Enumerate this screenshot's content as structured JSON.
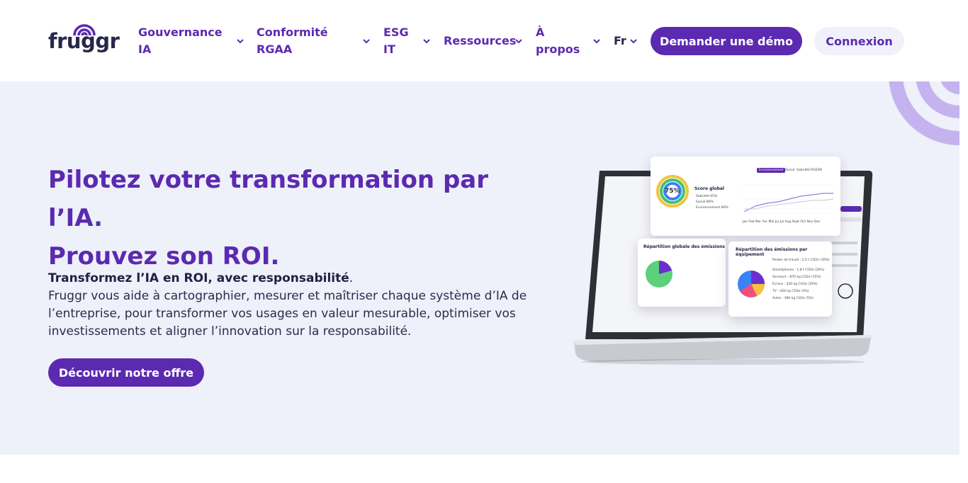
{
  "brand": {
    "name": "fruggr",
    "primary": "#5b2ab0",
    "dark": "#27274a",
    "hero_bg": "#eef0fa"
  },
  "nav": {
    "items": [
      {
        "label": "Gouvernance IA",
        "line1": "Gouvernance",
        "line2": "IA"
      },
      {
        "label": "Conformité RGAA",
        "line1": "Conformité",
        "line2": "RGAA"
      },
      {
        "label": "ESG IT",
        "line1": "ESG",
        "line2": "IT"
      },
      {
        "label": "Ressources",
        "line1": "Ressources",
        "line2": ""
      },
      {
        "label": "À propos",
        "line1": "À",
        "line2": "propos"
      }
    ],
    "language": "Fr",
    "demo_button": "Demander une démo",
    "login_button": "Connexion"
  },
  "hero": {
    "title_line1": "Pilotez votre transformation par l’IA.",
    "title_line2": "Prouvez son ROI.",
    "lead_bold": "Transformez l’IA en ROI, avec responsabilité",
    "lead_end": ".",
    "body": "Fruggr vous aide à cartographier, mesurer et maîtriser chaque système d’IA de l’entreprise, pour transformer vos usages en valeur mesurable, optimiser vos investissements et aligner l’innovation sur la responsabilité.",
    "cta": "Découvrir notre offre"
  },
  "dashboard": {
    "score_title": "Score global",
    "score_value": "75%",
    "score_items": [
      "Sobriété 65%",
      "Social 86%",
      "Environnement 80%"
    ],
    "tabs": [
      "Environnement",
      "Social",
      "Sobriété",
      "RGESN"
    ],
    "months": [
      "Jan",
      "Feb",
      "Mar",
      "Avr",
      "Mai",
      "Jui",
      "Jul",
      "Aug",
      "Sept",
      "Oct",
      "Nov",
      "Dec"
    ],
    "panel_global": "Répartition globale des émissions",
    "panel_equipment": "Répartition des émissions par équipement",
    "equipment_items": [
      "Postes de travail : 2,5 t CO2e (30%)",
      "Smartphones : 1,8 t CO2e (20%)",
      "Serveurs : 870 kg CO2e (15%)",
      "Écrans : 420 kg CO2e (10%)",
      "TV : 420 kg CO2e (5%)",
      "Autre : 380 kg CO2e (5%)"
    ]
  }
}
